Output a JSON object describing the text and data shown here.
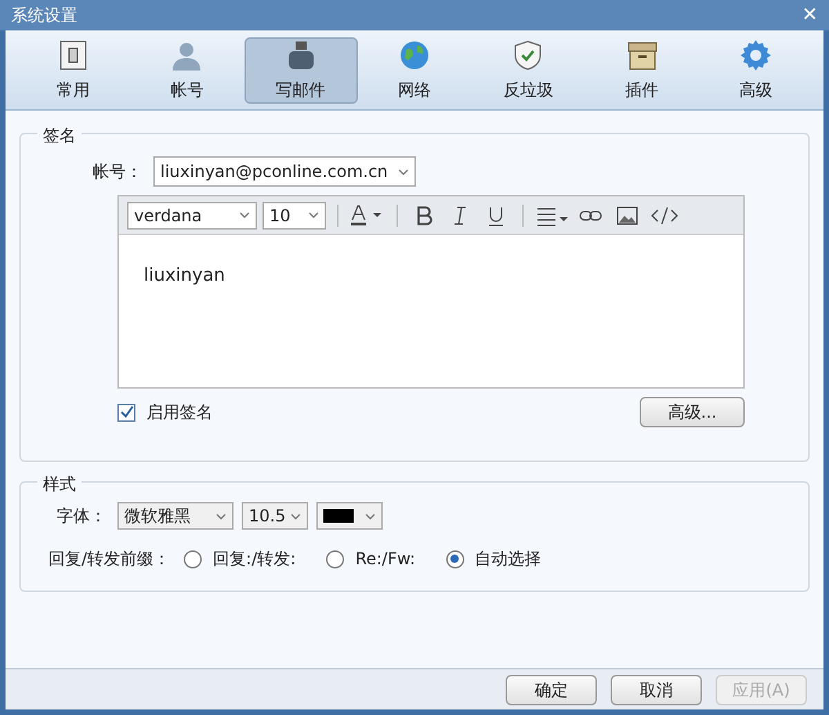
{
  "window": {
    "title": "系统设置",
    "close": "✕"
  },
  "tabs": [
    {
      "label": "常用",
      "kind": "general",
      "selected": false
    },
    {
      "label": "帐号",
      "kind": "account",
      "selected": false
    },
    {
      "label": "写邮件",
      "kind": "compose",
      "selected": true
    },
    {
      "label": "网络",
      "kind": "network",
      "selected": false
    },
    {
      "label": "反垃圾",
      "kind": "antispam",
      "selected": false
    },
    {
      "label": "插件",
      "kind": "plugin",
      "selected": false
    },
    {
      "label": "高级",
      "kind": "advanced",
      "selected": false
    }
  ],
  "signature": {
    "legend": "签名",
    "account_label": "帐号：",
    "account_value": "liuxinyan@pconline.com.cn",
    "font_value": "verdana",
    "size_value": "10",
    "body": "liuxinyan",
    "enable_label": "启用签名",
    "enabled": true,
    "advanced_button": "高级..."
  },
  "style": {
    "legend": "样式",
    "font_label": "字体：",
    "font_value": "微软雅黑",
    "size_value": "10.5",
    "color": "#000000",
    "prefix_label": "回复/转发前缀：",
    "prefix_options": [
      {
        "label": "回复:/转发:",
        "selected": false
      },
      {
        "label": "Re:/Fw:",
        "selected": false
      },
      {
        "label": "自动选择",
        "selected": true
      }
    ]
  },
  "buttons": [
    {
      "label": "确定",
      "disabled": false
    },
    {
      "label": "取消",
      "disabled": false
    },
    {
      "label": "应用(A)",
      "disabled": true
    }
  ]
}
